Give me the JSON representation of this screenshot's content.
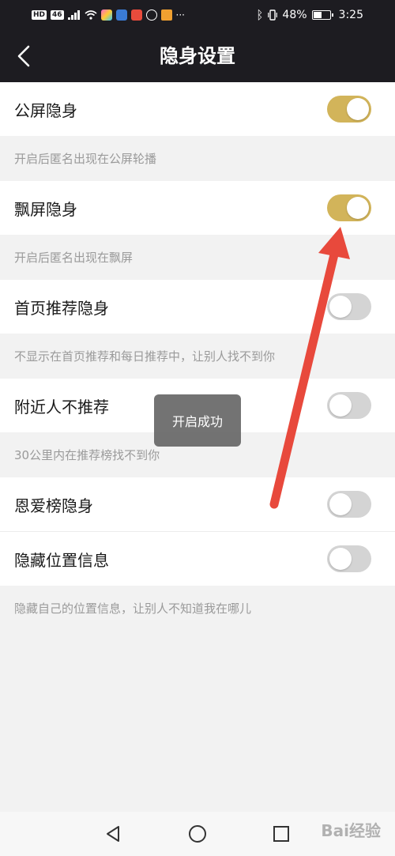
{
  "status_bar": {
    "signal_badges": [
      "HD",
      "46"
    ],
    "bluetooth": "ᛒ",
    "battery_percent": "48%",
    "time": "3:25",
    "more": "···"
  },
  "header": {
    "title": "隐身设置"
  },
  "settings": [
    {
      "label": "公屏隐身",
      "enabled": true,
      "description": "开启后匿名出现在公屏轮播"
    },
    {
      "label": "飘屏隐身",
      "enabled": true,
      "description": "开启后匿名出现在飘屏"
    },
    {
      "label": "首页推荐隐身",
      "enabled": false,
      "description": "不显示在首页推荐和每日推荐中，让别人找不到你"
    },
    {
      "label": "附近人不推荐",
      "enabled": false,
      "description": "30公里内在推荐榜找不到你"
    },
    {
      "label": "恩爱榜隐身",
      "enabled": false,
      "description": ""
    },
    {
      "label": "隐藏位置信息",
      "enabled": false,
      "description": "隐藏自己的位置信息，让别人不知道我在哪儿"
    }
  ],
  "toast": {
    "message": "开启成功"
  },
  "watermark": "Bai经验",
  "colors": {
    "accent": "#d2b45a",
    "toggle_off": "#d4d4d4",
    "header_bg": "#1d1c21",
    "annotation_arrow": "#e8493c"
  }
}
